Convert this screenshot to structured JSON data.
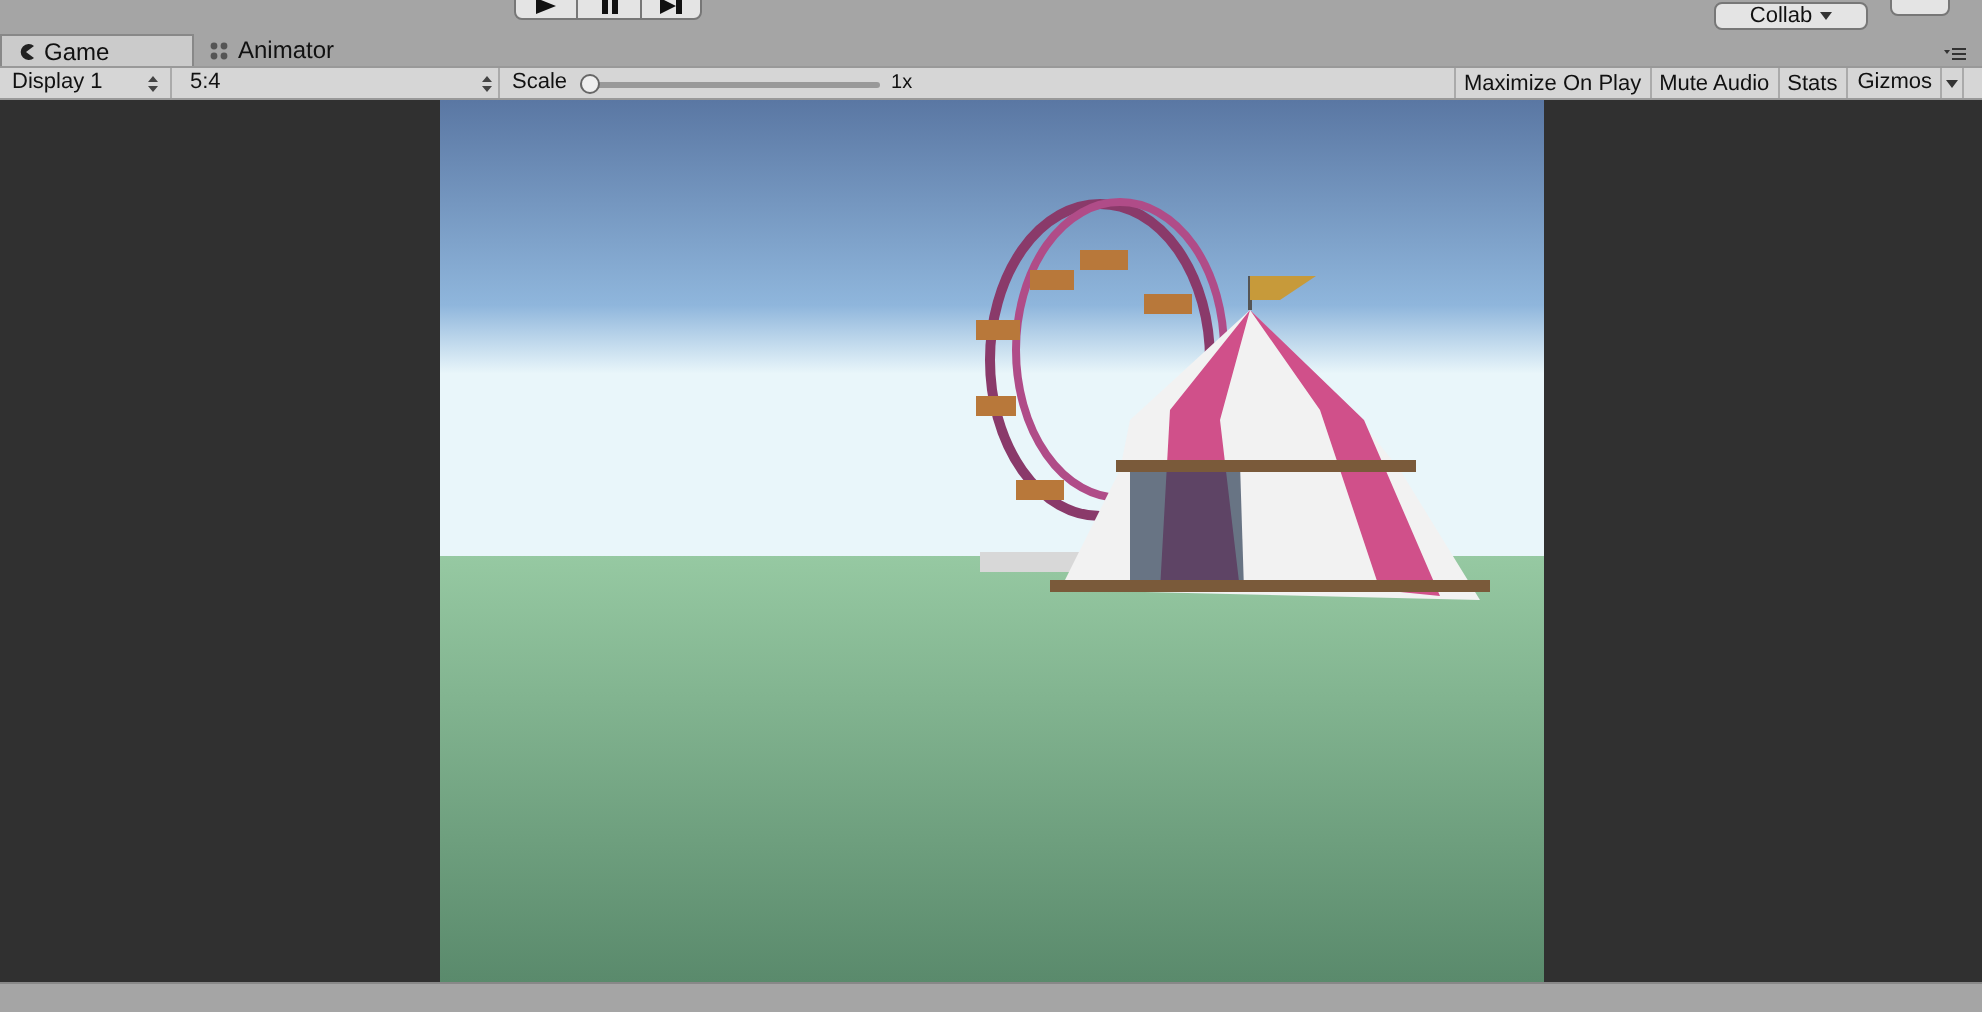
{
  "top_toolbar": {
    "collab_button": "Collab"
  },
  "tabs": [
    {
      "label": "Game",
      "selected": true
    },
    {
      "label": "Animator",
      "selected": false
    }
  ],
  "game_toolbar": {
    "display": "Display 1",
    "aspect": "5:4",
    "scale": {
      "label": "Scale",
      "level": 0,
      "reading": "1x"
    },
    "toggles": [
      "Maximize On Play",
      "Mute Audio",
      "Stats"
    ],
    "gizmos": "Gizmos"
  }
}
